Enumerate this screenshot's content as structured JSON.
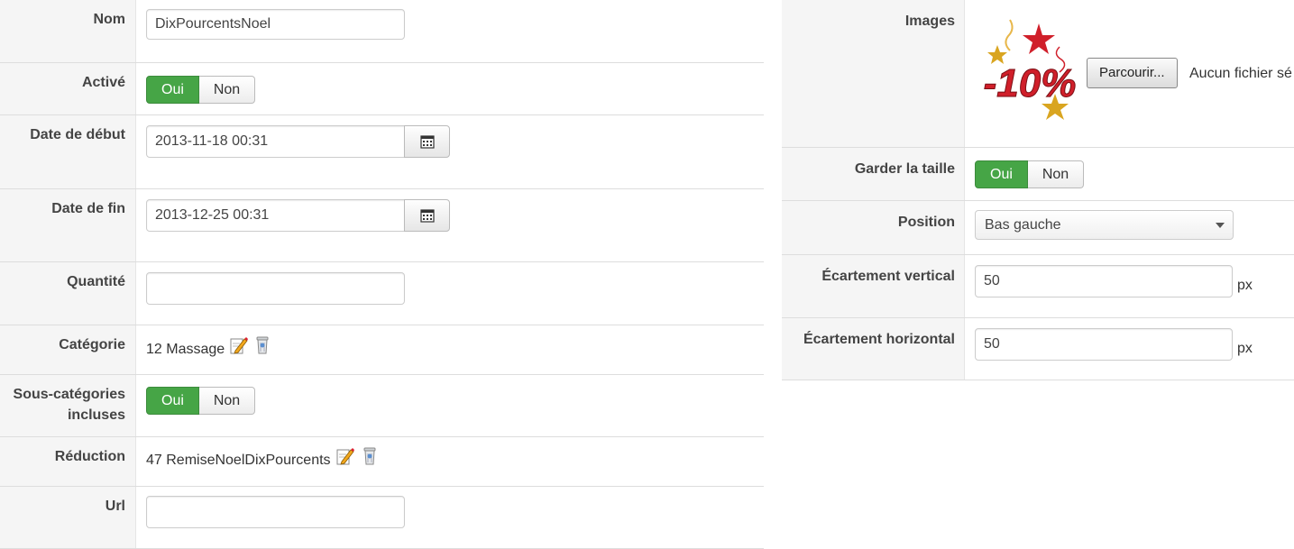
{
  "left_form": {
    "nom": {
      "label": "Nom",
      "value": "DixPourcentsNoel"
    },
    "active": {
      "label": "Activé",
      "yes": "Oui",
      "no": "Non",
      "selected": "Oui"
    },
    "date_debut": {
      "label": "Date de début",
      "value": "2013-11-18 00:31"
    },
    "date_fin": {
      "label": "Date de fin",
      "value": "2013-12-25 00:31"
    },
    "quantite": {
      "label": "Quantité",
      "value": ""
    },
    "categorie": {
      "label": "Catégorie",
      "value": "12 Massage"
    },
    "sous_categories": {
      "label": "Sous-catégories incluses",
      "yes": "Oui",
      "no": "Non",
      "selected": "Oui"
    },
    "reduction": {
      "label": "Réduction",
      "value": "47 RemiseNoelDixPourcents"
    },
    "url": {
      "label": "Url",
      "value": ""
    }
  },
  "right_form": {
    "images": {
      "label": "Images",
      "browse_button": "Parcourir...",
      "file_status": "Aucun fichier sé",
      "thumbnail_text": "-10%"
    },
    "garder_taille": {
      "label": "Garder la taille",
      "yes": "Oui",
      "no": "Non",
      "selected": "Oui"
    },
    "position": {
      "label": "Position",
      "selected": "Bas gauche"
    },
    "ecart_vertical": {
      "label": "Écartement vertical",
      "value": "50",
      "unit": "px"
    },
    "ecart_horizontal": {
      "label": "Écartement horizontal",
      "value": "50",
      "unit": "px"
    }
  },
  "colors": {
    "toggle_on": "#46a546",
    "label_bg": "#f5f5f5",
    "promo_red": "#d01f2a",
    "star_gold": "#d9a520"
  },
  "icons": {
    "calendar": "calendar-icon",
    "edit": "pencil-edit-icon",
    "delete": "trash-icon"
  }
}
